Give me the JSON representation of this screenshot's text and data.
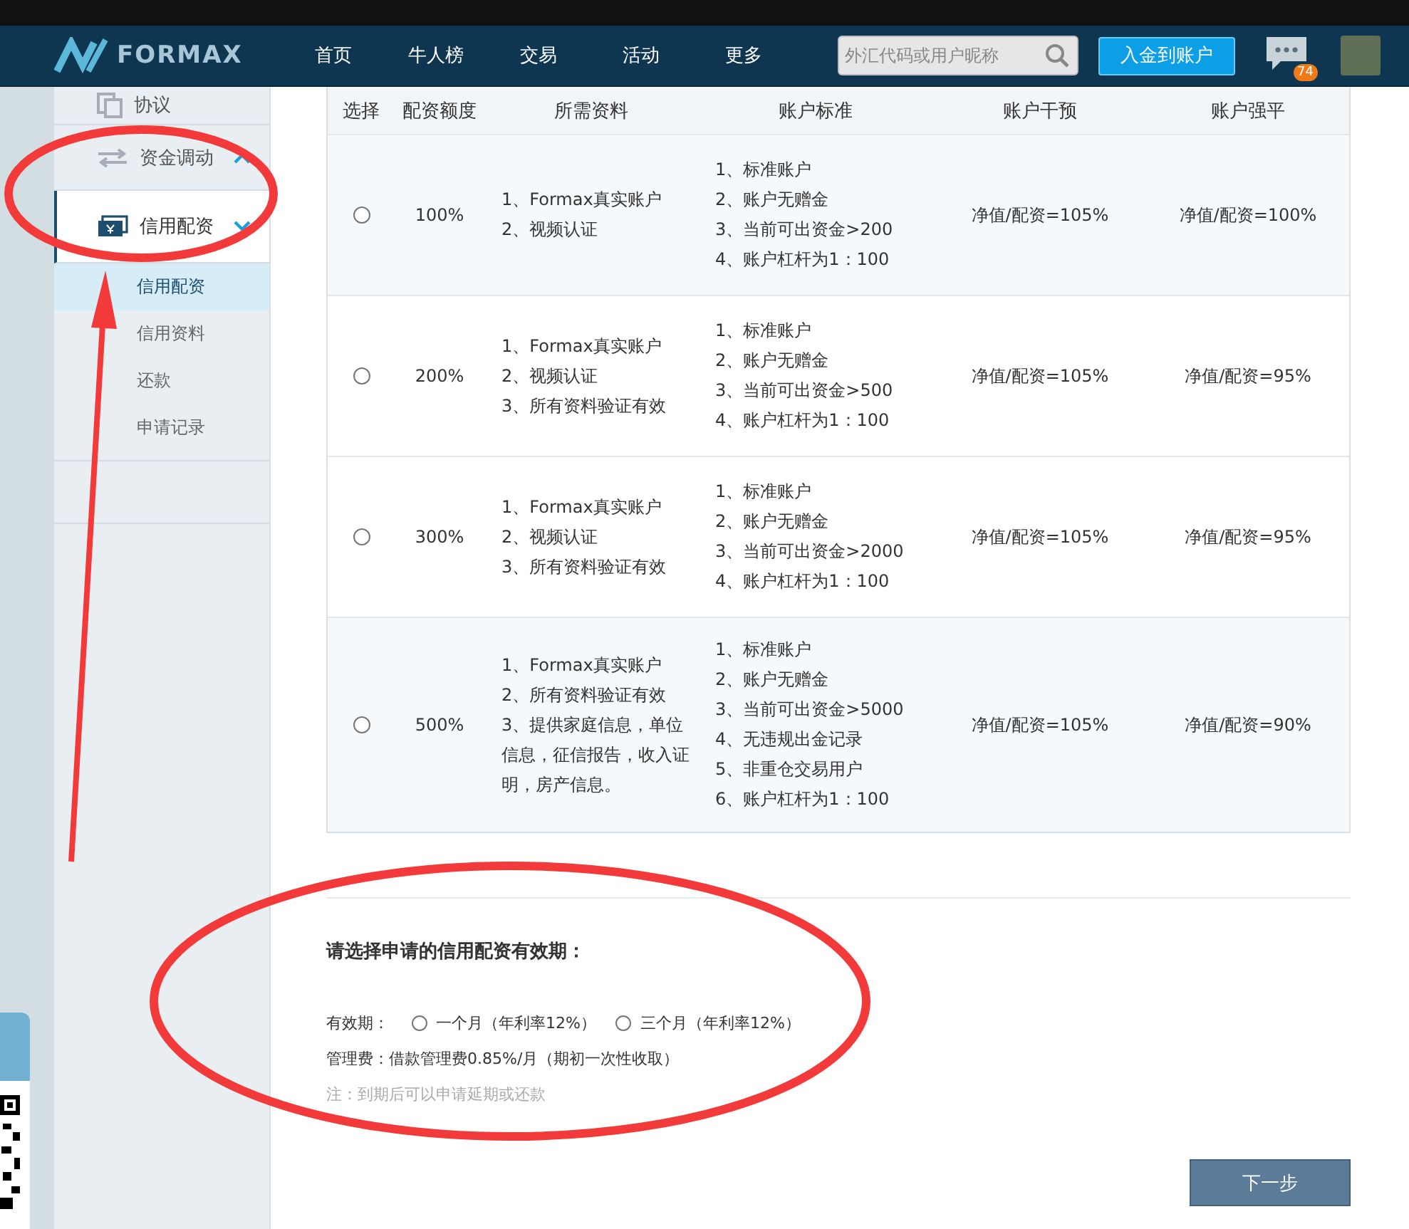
{
  "header": {
    "logo": "FORMAX",
    "menu": [
      {
        "label": "首页"
      },
      {
        "label": "牛人榜"
      },
      {
        "label": "交易"
      },
      {
        "label": "活动"
      },
      {
        "label": "更多"
      }
    ],
    "search": {
      "placeholder": "外汇代码或用户昵称"
    },
    "deposit_button": "入金到账户",
    "messages_badge": "74"
  },
  "sidebar": {
    "items": [
      {
        "label": "协议",
        "kind": "copy",
        "selected": false
      },
      {
        "label": "资金调动",
        "kind": "transfer",
        "expanded": false,
        "selected": false
      },
      {
        "label": "信用配资",
        "kind": "money",
        "expanded": true,
        "selected": true,
        "children": [
          {
            "label": "信用配资",
            "selected": true
          },
          {
            "label": "信用资料",
            "selected": false
          },
          {
            "label": "还款",
            "selected": false
          },
          {
            "label": "申请记录",
            "selected": false
          }
        ]
      }
    ]
  },
  "table": {
    "columns": [
      "选择",
      "配资额度",
      "所需资料",
      "账户标准",
      "账户干预",
      "账户强平"
    ],
    "rows": [
      {
        "selected": false,
        "amount": "100%",
        "requirements": [
          "1、Formax真实账户",
          "2、视频认证"
        ],
        "standards": [
          "1、标准账户",
          "2、账户无赠金",
          "3、当前可出资金>200",
          "4、账户杠杆为1：100"
        ],
        "intervention": "净值/配资=105%",
        "liquidation": "净值/配资=100%"
      },
      {
        "selected": false,
        "amount": "200%",
        "requirements": [
          "1、Formax真实账户",
          "2、视频认证",
          "3、所有资料验证有效"
        ],
        "standards": [
          "1、标准账户",
          "2、账户无赠金",
          "3、当前可出资金>500",
          "4、账户杠杆为1：100"
        ],
        "intervention": "净值/配资=105%",
        "liquidation": "净值/配资=95%"
      },
      {
        "selected": false,
        "amount": "300%",
        "requirements": [
          "1、Formax真实账户",
          "2、视频认证",
          "3、所有资料验证有效"
        ],
        "standards": [
          "1、标准账户",
          "2、账户无赠金",
          "3、当前可出资金>2000",
          "4、账户杠杆为1：100"
        ],
        "intervention": "净值/配资=105%",
        "liquidation": "净值/配资=95%"
      },
      {
        "selected": false,
        "amount": "500%",
        "requirements": [
          "1、Formax真实账户",
          "2、所有资料验证有效",
          "3、提供家庭信息，单位信息，征信报告，收入证明，房产信息。"
        ],
        "standards": [
          "1、标准账户",
          "2、账户无赠金",
          "3、当前可出资金>5000",
          "4、无违规出金记录",
          "5、非重仓交易用户",
          "6、账户杠杆为1：100"
        ],
        "intervention": "净值/配资=105%",
        "liquidation": "净值/配资=90%"
      }
    ]
  },
  "term": {
    "title": "请选择申请的信用配资有效期：",
    "label": "有效期：",
    "options": [
      {
        "label": "一个月（年利率12%）",
        "selected": false
      },
      {
        "label": "三个月（年利率12%）",
        "selected": false
      }
    ],
    "fee": "管理费：借款管理费0.85%/月（期初一次性收取）",
    "note": "注：到期后可以申请延期或还款"
  },
  "next_button": "下一步"
}
